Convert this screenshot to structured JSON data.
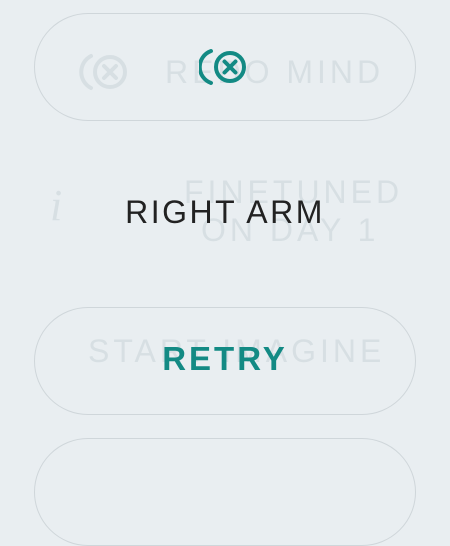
{
  "background_card": {
    "top_label": "REDO MIND",
    "middle_line1": "FINETUNED",
    "middle_line2": "ON DAY 1",
    "bottom_label": "START IMAGINE",
    "info_glyph": "i"
  },
  "dialog": {
    "icon": "cancel-circle-icon",
    "message": "RIGHT ARM",
    "retry_label": "RETRY"
  },
  "colors": {
    "background": "#e9eef1",
    "accent": "#138a84",
    "faded": "#d7dfe3",
    "text": "#222222"
  }
}
